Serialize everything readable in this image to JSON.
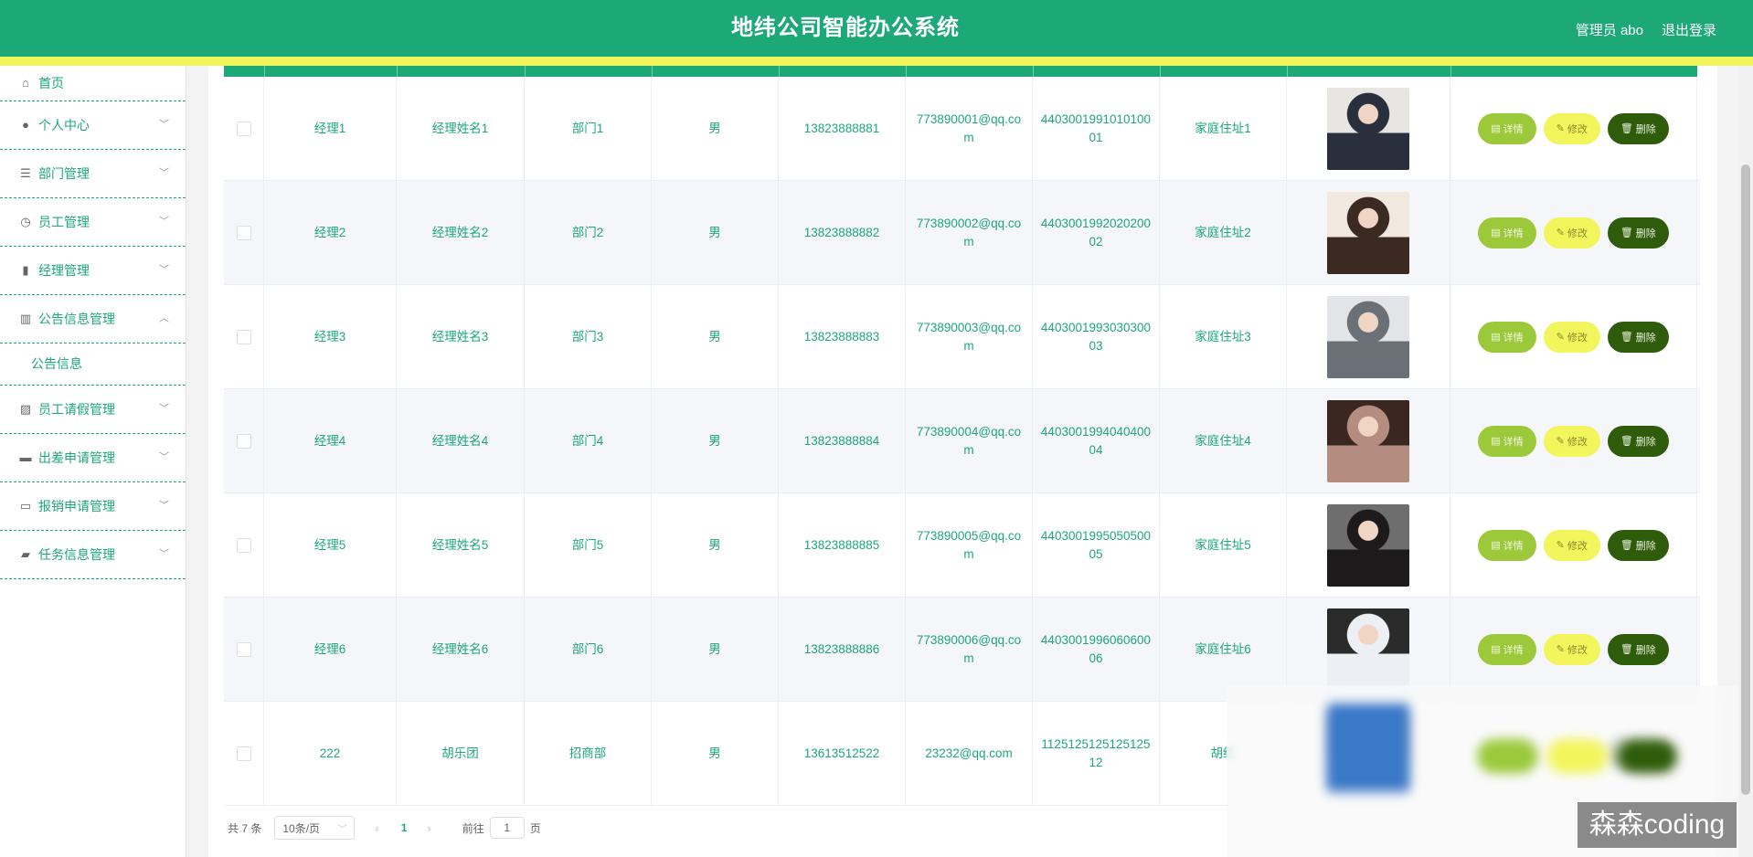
{
  "header": {
    "title": "地纬公司智能办公系统",
    "admin": "管理员 abo",
    "logout": "退出登录"
  },
  "sidebar": {
    "items": [
      {
        "label": "首页",
        "icon": "home-icon",
        "glyph": "⌂"
      },
      {
        "label": "个人中心",
        "icon": "user-icon",
        "glyph": "●"
      },
      {
        "label": "部门管理",
        "icon": "list-icon",
        "glyph": "☰"
      },
      {
        "label": "员工管理",
        "icon": "clock-icon",
        "glyph": "◷"
      },
      {
        "label": "经理管理",
        "icon": "badge-icon",
        "glyph": "▮"
      },
      {
        "label": "公告信息管理",
        "icon": "bar-chart-icon",
        "glyph": "▥"
      },
      {
        "label": "员工请假管理",
        "icon": "trend-icon",
        "glyph": "▨"
      },
      {
        "label": "出差申请管理",
        "icon": "printer-icon",
        "glyph": "▬"
      },
      {
        "label": "报销申请管理",
        "icon": "monitor-icon",
        "glyph": "▭"
      },
      {
        "label": "任务信息管理",
        "icon": "ticket-icon",
        "glyph": "▰"
      }
    ],
    "sub_item": "公告信息"
  },
  "table": {
    "rows": [
      {
        "account": "经理1",
        "name": "经理姓名1",
        "dept": "部门1",
        "gender": "男",
        "phone": "13823888881",
        "email": "773890001@qq.com",
        "id_card": "440300199101010001",
        "address": "家庭住址1"
      },
      {
        "account": "经理2",
        "name": "经理姓名2",
        "dept": "部门2",
        "gender": "男",
        "phone": "13823888882",
        "email": "773890002@qq.com",
        "id_card": "440300199202020002",
        "address": "家庭住址2"
      },
      {
        "account": "经理3",
        "name": "经理姓名3",
        "dept": "部门3",
        "gender": "男",
        "phone": "13823888883",
        "email": "773890003@qq.com",
        "id_card": "440300199303030003",
        "address": "家庭住址3"
      },
      {
        "account": "经理4",
        "name": "经理姓名4",
        "dept": "部门4",
        "gender": "男",
        "phone": "13823888884",
        "email": "773890004@qq.com",
        "id_card": "440300199404040004",
        "address": "家庭住址4"
      },
      {
        "account": "经理5",
        "name": "经理姓名5",
        "dept": "部门5",
        "gender": "男",
        "phone": "13823888885",
        "email": "773890005@qq.com",
        "id_card": "440300199505050005",
        "address": "家庭住址5"
      },
      {
        "account": "经理6",
        "name": "经理姓名6",
        "dept": "部门6",
        "gender": "男",
        "phone": "13823888886",
        "email": "773890006@qq.com",
        "id_card": "440300199606060006",
        "address": "家庭住址6"
      },
      {
        "account": "222",
        "name": "胡乐团",
        "dept": "招商部",
        "gender": "男",
        "phone": "13613512522",
        "email": "23232@qq.com",
        "id_card": "112512512512512512",
        "address": "胡继"
      }
    ],
    "actions": {
      "detail": "详情",
      "edit": "修改",
      "delete": "删除"
    }
  },
  "pager": {
    "total": "共 7 条",
    "size": "10条/页",
    "current": "1",
    "goto": "前往",
    "page": "页",
    "input": "1"
  },
  "watermark": "森森coding",
  "colors": {
    "primary": "#1da878",
    "accent": "#f0f55c",
    "detail": "#9bc93a",
    "edit": "#f2f55b",
    "delete": "#2f5c0a"
  }
}
